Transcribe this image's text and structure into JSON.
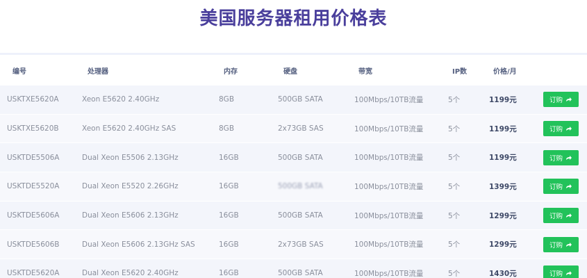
{
  "title": "美国服务器租用价格表",
  "columns": {
    "id": "编号",
    "cpu": "处理器",
    "mem": "内存",
    "disk": "硬盘",
    "bw": "带宽",
    "ip": "IP数",
    "price": "价格/月"
  },
  "buy_label": "订购",
  "rows": [
    {
      "id": "USKTXE5620A",
      "cpu": "Xeon E5620 2.40GHz",
      "mem": "8GB",
      "disk": "500GB SATA",
      "bw": "100Mbps/10TB流量",
      "ip": "5个",
      "price": "1199元"
    },
    {
      "id": "USKTXE5620B",
      "cpu": "Xeon E5620 2.40GHz SAS",
      "mem": "8GB",
      "disk": "2x73GB SAS",
      "bw": "100Mbps/10TB流量",
      "ip": "5个",
      "price": "1199元"
    },
    {
      "id": "USKTDE5506A",
      "cpu": "Dual Xeon E5506 2.13GHz",
      "mem": "16GB",
      "disk": "500GB SATA",
      "bw": "100Mbps/10TB流量",
      "ip": "5个",
      "price": "1199元"
    },
    {
      "id": "USKTDE5520A",
      "cpu": "Dual Xeon E5520 2.26GHz",
      "mem": "16GB",
      "disk": "500GB SATA",
      "bw": "100Mbps/10TB流量",
      "ip": "5个",
      "price": "1399元"
    },
    {
      "id": "USKTDE5606A",
      "cpu": "Dual Xeon E5606 2.13GHz",
      "mem": "16GB",
      "disk": "500GB SATA",
      "bw": "100Mbps/10TB流量",
      "ip": "5个",
      "price": "1299元"
    },
    {
      "id": "USKTDE5606B",
      "cpu": "Dual Xeon E5606 2.13GHz SAS",
      "mem": "16GB",
      "disk": "2x73GB SAS",
      "bw": "100Mbps/10TB流量",
      "ip": "5个",
      "price": "1299元"
    },
    {
      "id": "USKTDE5620A",
      "cpu": "Dual Xeon E5620 2.40GHz",
      "mem": "16GB",
      "disk": "500GB SATA",
      "bw": "100Mbps/10TB流量",
      "ip": "5个",
      "price": "1430元"
    }
  ],
  "colors": {
    "title": "#4a3f9c",
    "buy_button": "#22c25a",
    "row_bg": "#f3f5fb"
  },
  "icons": {
    "buy_arrow": "share-arrow-icon"
  }
}
